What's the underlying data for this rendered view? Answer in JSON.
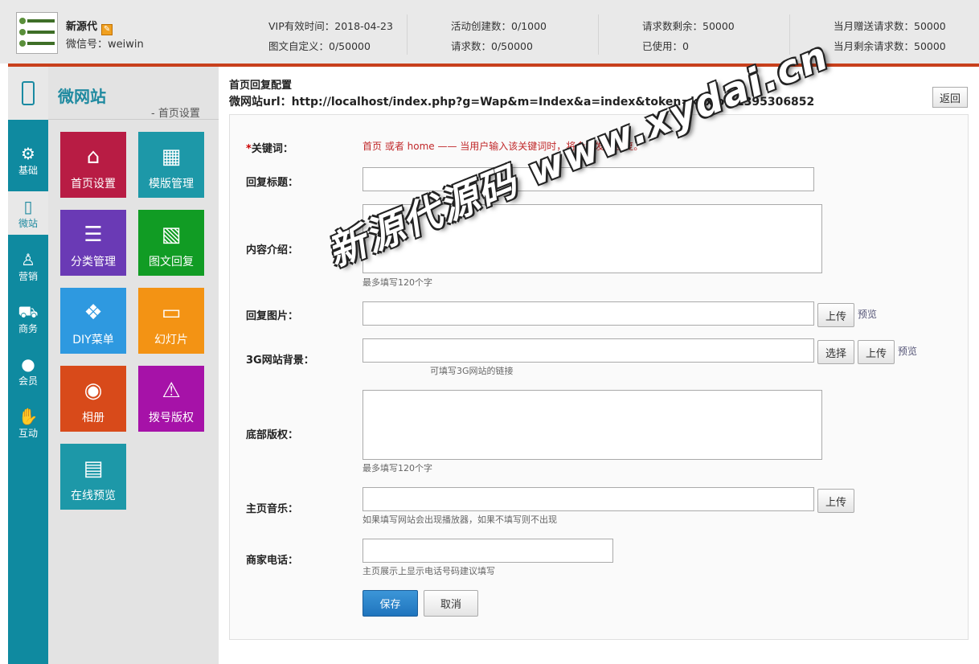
{
  "header": {
    "logo_text": "",
    "user_name": "新源代",
    "wechat_label": "微信号：weiwin",
    "stats": [
      "VIP有效时间：2018-04-23",
      "图文自定义：0/50000",
      "活动创建数：0/1000",
      "请求数：0/50000",
      "请求数剩余：50000",
      "已使用：0",
      "当月赠送请求数：50000",
      "当月剩余请求数：50000"
    ]
  },
  "section": {
    "title": "微网站",
    "subtitle": "- 首页设置"
  },
  "nav": [
    {
      "label": "基础",
      "icon": "gear-icon"
    },
    {
      "label": "微站",
      "icon": "phone-icon"
    },
    {
      "label": "营销",
      "icon": "people-icon"
    },
    {
      "label": "商务",
      "icon": "cart-icon"
    },
    {
      "label": "会员",
      "icon": "user-icon"
    },
    {
      "label": "互动",
      "icon": "handshake-icon"
    }
  ],
  "tiles": [
    {
      "label": "首页设置",
      "icon": "home-icon",
      "color": "#b81c44"
    },
    {
      "label": "模版管理",
      "icon": "building-icon",
      "color": "#1d98a8"
    },
    {
      "label": "分类管理",
      "icon": "list-icon",
      "color": "#6a3ab5"
    },
    {
      "label": "图文回复",
      "icon": "image-icon",
      "color": "#119c24"
    },
    {
      "label": "DIY菜单",
      "icon": "dropbox-icon",
      "color": "#2e99e0"
    },
    {
      "label": "幻灯片",
      "icon": "monitor-icon",
      "color": "#f39314"
    },
    {
      "label": "相册",
      "icon": "camera-icon",
      "color": "#d84a1a"
    },
    {
      "label": "拨号版权",
      "icon": "warning-icon",
      "color": "#a612a8"
    },
    {
      "label": "在线预览",
      "icon": "clapper-icon",
      "color": "#1d98a8"
    }
  ],
  "config": {
    "title": "首页回复配置",
    "url": "微网站url：http://localhost/index.php?g=Wap&m=Index&a=index&token=kaxlom1395306852",
    "back_label": "返回"
  },
  "form": {
    "keyword_required": "*",
    "keyword_label": "关键词：",
    "keyword_note": "首页 或者 home —— 当用户输入该关键词时，将会触发此回复。",
    "reply_title_label": "回复标题：",
    "content_label": "内容介绍：",
    "content_hint": "最多填写120个字",
    "image_label": "回复图片：",
    "upload_label": "上传",
    "preview_label": "预览",
    "bg3g_label": "3G网站背景：",
    "select_label": "选择",
    "bg3g_hint": "可填写3G网站的链接",
    "footer_label": "底部版权：",
    "footer_hint": "最多填写120个字",
    "music_label": "主页音乐：",
    "music_hint": "如果填写网站会出现播放器，如果不填写则不出现",
    "phone_label": "商家电话：",
    "phone_hint": "主页展示上显示电话号码建议填写",
    "save_label": "保存",
    "cancel_label": "取消"
  },
  "watermark": "新源代源码 www.xydai.cn"
}
